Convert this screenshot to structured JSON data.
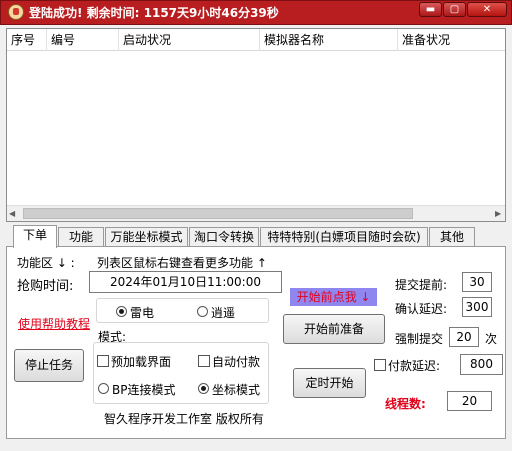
{
  "title": "登陆成功! 剩余时间: 1157天9小时46分39秒",
  "window_buttons": {
    "minimize": "▬",
    "maximize": "▢",
    "close": "✕"
  },
  "list": {
    "columns": [
      "序号",
      "编号",
      "启动状况",
      "模拟器名称",
      "准备状况"
    ]
  },
  "tabs": [
    "下单",
    "功能",
    "万能坐标模式",
    "淘口令转换",
    "特特特别(白嫖项目随时会砍)",
    "其他"
  ],
  "active_tab": "下单",
  "panel": {
    "function_area": "功能区 ↓ :",
    "list_hint": "列表区鼠标右键查看更多功能 ↑",
    "buy_time_label": "抢购时间:",
    "buy_time_value": "2024年01月10日11:00:00",
    "radio_leidian": "雷电",
    "radio_xiaoyao": "逍遥",
    "help_link": "使用帮助教程",
    "stop_button": "停止任务",
    "mode_label": "模式:",
    "preload_label": "预加载界面",
    "auto_pay_label": "自动付款",
    "bp_mode_label": "BP连接模式",
    "coord_mode_label": "坐标模式",
    "start_hint": "开始前点我 ↓",
    "prepare_button": "开始前准备",
    "timed_start_button": "定时开始",
    "copyright": "智久程序开发工作室 版权所有",
    "submit_ahead_label": "提交提前:",
    "submit_ahead_value": "30",
    "confirm_delay_label": "确认延迟:",
    "confirm_delay_value": "300",
    "force_submit_label": "强制提交",
    "force_submit_value": "20",
    "force_submit_unit": "次",
    "pay_delay_label": "付款延迟:",
    "pay_delay_value": "800",
    "threads_label": "线程数:",
    "threads_value": "20"
  },
  "colors": {
    "title_bar": "#b81e20",
    "accent_red": "#e0001a",
    "hint_bg": "#8f86f0",
    "hint_text": "#e8001a"
  }
}
